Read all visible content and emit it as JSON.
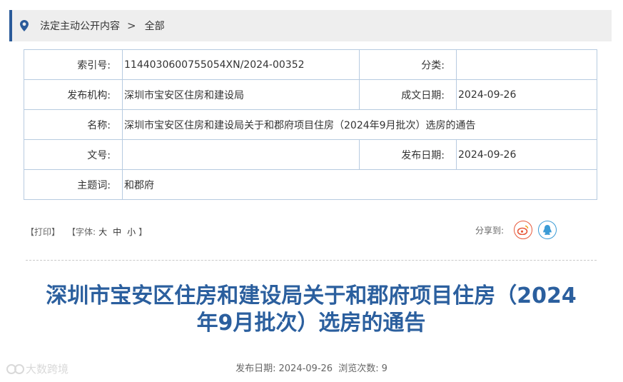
{
  "breadcrumb": {
    "items": [
      "法定主动公开内容",
      "全部"
    ],
    "separator": ">"
  },
  "meta": {
    "index_label": "索引号:",
    "index_value": "1144030600755054XN/2024-00352",
    "category_label": "分类:",
    "category_value": "",
    "publisher_label": "发布机构:",
    "publisher_value": "深圳市宝安区住房和建设局",
    "created_label": "成文日期:",
    "created_value": "2024-09-26",
    "name_label": "名称:",
    "name_value": "深圳市宝安区住房和建设局关于和郡府项目住房（2024年9月批次）选房的通告",
    "doc_no_label": "文号:",
    "doc_no_value": "",
    "publish_date_label": "发布日期:",
    "publish_date_value": "2024-09-26",
    "keywords_label": "主题词:",
    "keywords_value": "和郡府"
  },
  "toolbar": {
    "print": "【打印】",
    "font_prefix": "【字体:",
    "font_large": "大",
    "font_medium": "中",
    "font_small": "小",
    "font_suffix": "】",
    "share_label": "分享到:"
  },
  "article": {
    "title_line1": "深圳市宝安区住房和建设局关于和郡府项目住房（2024",
    "title_line2": "年9月批次）选房的通告",
    "publish_label": "发布日期:",
    "publish_date": "2024-09-26",
    "views_label": "浏览次数:",
    "views": "9"
  },
  "watermark": {
    "text": "大数跨境"
  },
  "colors": {
    "accent": "#2b5b9a",
    "title": "#2b5f9e",
    "table_border": "#b7cbe0",
    "weibo": "#e7593b",
    "qq": "#3a9bd6"
  },
  "icons": {
    "location": "map-pin-icon",
    "weibo": "weibo-icon",
    "qq": "qq-icon"
  }
}
